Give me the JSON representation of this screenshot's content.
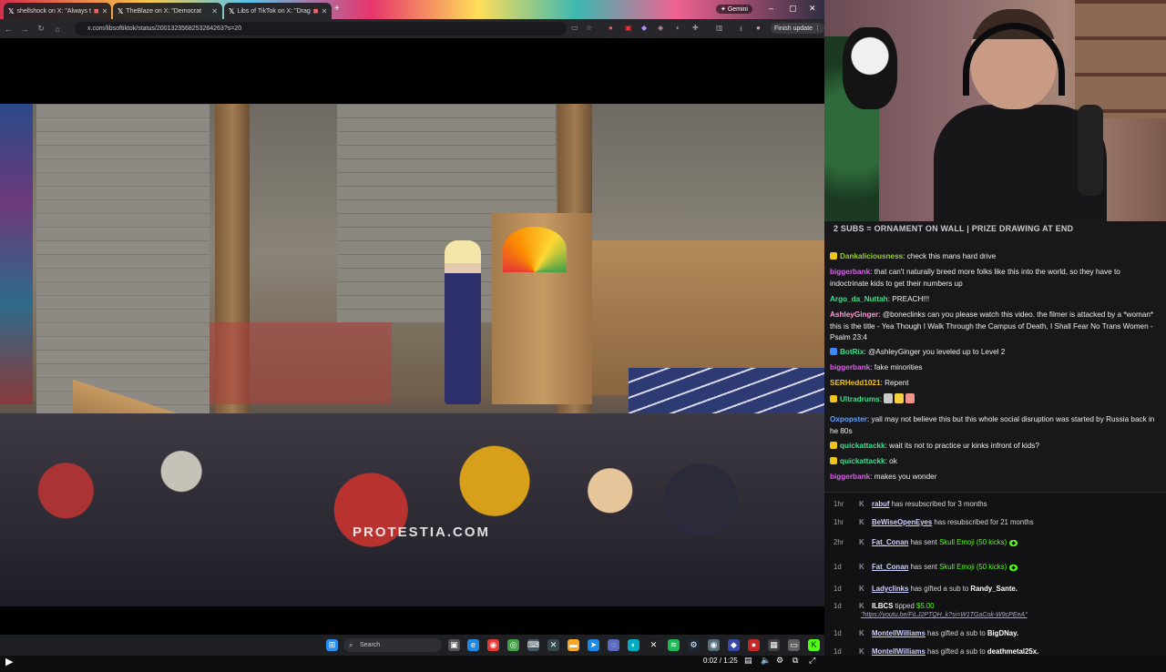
{
  "browser": {
    "tabs": [
      {
        "title": "shellshock on X: \"Always t",
        "active": false
      },
      {
        "title": "TheBlaze on X: \"Democrat",
        "active": false
      },
      {
        "title": "Libs of TikTok on X: \"Drag",
        "active": true
      }
    ],
    "gemini_label": "Gemini",
    "url": "x.com/libsoftiktok/status/2001323568253264263?s=20",
    "finish_update_label": "Finish update"
  },
  "video": {
    "watermark": "PROTESTIA.COM",
    "time_display": "0:02 / 1:25",
    "progress_fraction": 0.024
  },
  "taskbar": {
    "search_placeholder": "Search"
  },
  "chat": {
    "banner": "2 SUBS = ORNAMENT ON WALL | PRIZE DRAWING AT END",
    "messages": [
      {
        "user": "Dankaliciousness",
        "color": "#9acd32",
        "badge": "#f0c419",
        "text": "check this mans hard drive"
      },
      {
        "user": "biggerbank",
        "color": "#e05cf0",
        "badge": "",
        "text": "that can't naturally breed more folks like this into the world, so they have to indoctrinate kids to get their numbers up"
      },
      {
        "user": "Argo_da_Nuttah",
        "color": "#3ce08a",
        "badge": "",
        "text": "PREACH!!!"
      },
      {
        "user": "AshleyGinger",
        "color": "#ff9bd0",
        "badge": "",
        "text": "@boneclinks can you please watch this video. the filmer is attacked by a *woman* this is the title - Yea Though I Walk Through the Campus of Death, I Shall Fear No Trans Women - Psalm 23:4"
      },
      {
        "user": "BotRix",
        "color": "#3ce08a",
        "badge": "#3b8bff",
        "text": "@AshleyGinger you leveled up to Level 2"
      },
      {
        "user": "biggerbank",
        "color": "#e05cf0",
        "badge": "",
        "text": "fake minorities"
      },
      {
        "user": "SERHedd1021",
        "color": "#f0c419",
        "badge": "",
        "text": "Repent"
      },
      {
        "user": "Ultradrums",
        "color": "#3ce08a",
        "badge": "#f0c419",
        "text": ""
      },
      {
        "user": "Oxpopster",
        "color": "#5aa0ff",
        "badge": "",
        "text": "yall may not believe this but this whole social disruption was started by Russia back in he 80s"
      },
      {
        "user": "quickattackk",
        "color": "#3ce08a",
        "badge": "#f0c419",
        "text": "wait its not to practice ur kinks infront of kids?"
      },
      {
        "user": "quickattackk",
        "color": "#3ce08a",
        "badge": "#f0c419",
        "text": "ok"
      },
      {
        "user": "biggerbank",
        "color": "#e05cf0",
        "badge": "",
        "text": "makes you wonder"
      }
    ]
  },
  "feed": {
    "rows": [
      {
        "age": "1hr",
        "name": "rabuf",
        "text": " has resubscribed for 3 months"
      },
      {
        "age": "1hr",
        "name": "BeWiseOpenEyes",
        "text": " has resubscribed for 21 months"
      },
      {
        "age": "2hr",
        "name": "Fat_Conan",
        "text": " has sent ",
        "gift": "Skull Emoji (50 kicks)"
      },
      {
        "age": "1d",
        "name": "Fat_Conan",
        "text": " has sent ",
        "gift": "Skull Emoji (50 kicks)"
      },
      {
        "age": "1d",
        "name": "Ladyclinks",
        "text": " has gifted a sub to ",
        "target": "Randy_Sante."
      },
      {
        "age": "1d",
        "name": "ILBCS",
        "text": " tipped ",
        "amount": "$5.00",
        "link": "\"https://youtu.be/FiLJ2PTQH_k?si=W1TGaCok-W9cPEeA\""
      },
      {
        "age": "1d",
        "name": "MontellWilliams",
        "text": " has gifted a sub to ",
        "target": "BigDNay."
      },
      {
        "age": "1d",
        "name": "MontellWilliams",
        "text": " has gifted a sub to ",
        "target": "deathmetal25x."
      }
    ]
  },
  "colors": {
    "kick_green": "#53fc18",
    "chat_bg": "#18181b",
    "browser_bg": "#000000"
  }
}
